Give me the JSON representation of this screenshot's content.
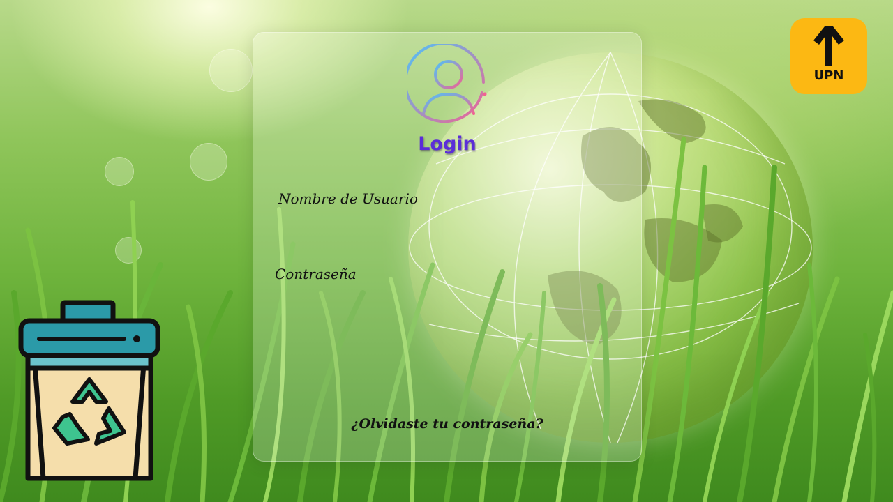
{
  "login": {
    "title": "Login",
    "username_label": "Nombre de Usuario",
    "password_label": "Contraseña",
    "username_value": "",
    "password_value": "",
    "forgot_password": "¿Olvidaste tu contraseña?"
  },
  "brand": {
    "logo_text": "UPN",
    "logo_color": "#fcb813"
  },
  "icons": {
    "avatar": "user-circle-icon",
    "recycle_bin": "recycle-bin-icon"
  },
  "colors": {
    "title": "#5b2dd8",
    "avatar_gradient_start": "#4fc3f7",
    "avatar_gradient_end": "#f06292",
    "bin_lid": "#2b9aa8",
    "bin_body": "#f5deab",
    "recycle_symbol": "#3ec48f"
  }
}
